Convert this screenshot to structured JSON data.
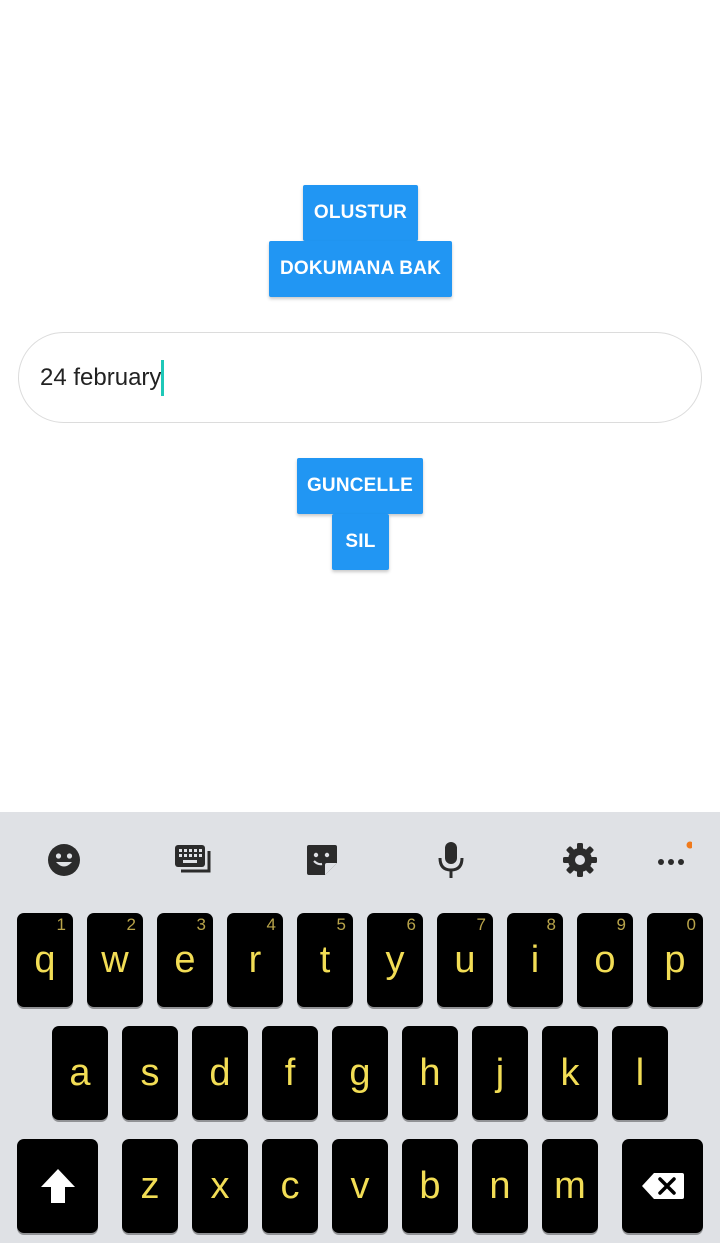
{
  "buttons": {
    "create": "OLUSTUR",
    "view_document": "DOKUMANA BAK",
    "update": "GUNCELLE",
    "delete": "SIL"
  },
  "input": {
    "value": "24 february"
  },
  "colors": {
    "button_bg": "#2196f3",
    "caret": "#1fc8b8",
    "keyboard_bg": "#dfe1e5",
    "key_bg": "#000000",
    "key_text": "#f2dd55",
    "notification_dot": "#f07a1c"
  },
  "keyboard": {
    "toolbar": [
      "emoji-icon",
      "keyboard-switch-icon",
      "sticker-icon",
      "microphone-icon",
      "gear-icon",
      "more-icon"
    ],
    "row1": [
      {
        "label": "q",
        "hint": "1"
      },
      {
        "label": "w",
        "hint": "2"
      },
      {
        "label": "e",
        "hint": "3"
      },
      {
        "label": "r",
        "hint": "4"
      },
      {
        "label": "t",
        "hint": "5"
      },
      {
        "label": "y",
        "hint": "6"
      },
      {
        "label": "u",
        "hint": "7"
      },
      {
        "label": "i",
        "hint": "8"
      },
      {
        "label": "o",
        "hint": "9"
      },
      {
        "label": "p",
        "hint": "0"
      }
    ],
    "row2": [
      "a",
      "s",
      "d",
      "f",
      "g",
      "h",
      "j",
      "k",
      "l"
    ],
    "row3": [
      "z",
      "x",
      "c",
      "v",
      "b",
      "n",
      "m"
    ]
  }
}
